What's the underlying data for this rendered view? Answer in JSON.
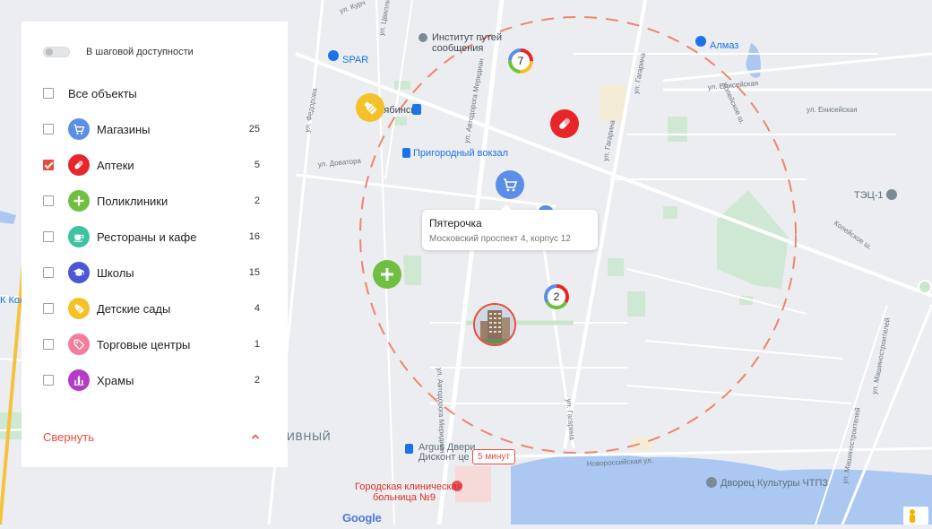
{
  "sidebar": {
    "walk_toggle_label": "В шаговой доступности",
    "all_label": "Все объекты",
    "categories": [
      {
        "label": "Магазины",
        "count": "25",
        "color": "#5b8ee6",
        "icon": "shopping-cart-icon",
        "checked": false
      },
      {
        "label": "Аптеки",
        "count": "5",
        "color": "#e8262a",
        "icon": "pill-icon",
        "checked": true
      },
      {
        "label": "Поликлиники",
        "count": "2",
        "color": "#6fbf40",
        "icon": "plus-cross-icon",
        "checked": false
      },
      {
        "label": "Рестораны и кафе",
        "count": "16",
        "color": "#3ec3a0",
        "icon": "coffee-cup-icon",
        "checked": false
      },
      {
        "label": "Школы",
        "count": "15",
        "color": "#4a57d6",
        "icon": "graduation-cap-icon",
        "checked": false
      },
      {
        "label": "Детские сады",
        "count": "4",
        "color": "#f5c12a",
        "icon": "baby-bottle-icon",
        "checked": false
      },
      {
        "label": "Торговые центры",
        "count": "1",
        "color": "#f27e9c",
        "icon": "price-tag-icon",
        "checked": false
      },
      {
        "label": "Храмы",
        "count": "2",
        "color": "#b43cc4",
        "icon": "temple-icon",
        "checked": false
      }
    ],
    "collapse_label": "Свернуть"
  },
  "tooltip": {
    "title": "Пятерочка",
    "address": "Московский проспект 4, корпус 12"
  },
  "walk_time_badge": "5 минут",
  "clusters": {
    "top": "7",
    "middle": "2"
  },
  "map": {
    "pois": {
      "institute": "Институт путей",
      "institute2": "сообщения",
      "spar": "SPAR",
      "almaz": "Алмаз",
      "station_partial": "лябинск",
      "prigorodny": "Пригородный вокзал",
      "tec": "ТЭЦ-1",
      "argus1": "Argus Двери",
      "argus2": "Дисконт це",
      "hospital1": "Городская клиническая",
      "hospital2": "больница №9",
      "dvorets": "Дворец Культуры ЧТПЗ",
      "district": "ИВНЫЙ",
      "k_kol": "К Кол"
    },
    "streets": {
      "eniseyskaya1": "ул. Енисейская",
      "eniseyskaya2": "ул. Енисейская",
      "tsvillinga": "ул. Цвиллинга",
      "kurchatova": "ул. Курч",
      "fedorova": "ул. Федорова",
      "dovatora": "ул. Доватора",
      "avtodoroga1": "ул. Автодорога Меридиан",
      "avtodoroga2": "ул. Автодорога Меридиан",
      "gagarina1": "ул. Гагарина",
      "gagarina2": "ул. Гагарина",
      "gagarina3": "ул. Гагарина",
      "kopeyskoe1": "Копейское ш.",
      "kopeyskoe2": "Копейское ш.",
      "mashinostr1": "ул. Машиностроителей",
      "mashinostr2": "ул. Машиностроителей",
      "novorossiyskaya": "Новороссийская ул."
    },
    "google": "Google",
    "accent": "#e84c3d"
  }
}
